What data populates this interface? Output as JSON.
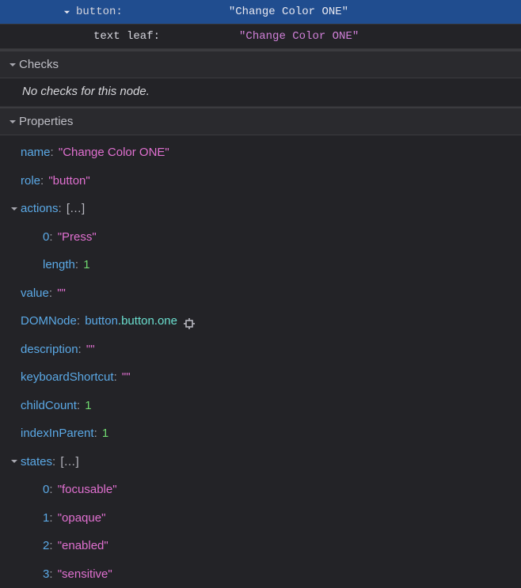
{
  "tree": {
    "node1": {
      "type": "button",
      "text": "\"Change Color ONE\""
    },
    "node2": {
      "type": "text leaf",
      "text": "\"Change Color ONE\""
    }
  },
  "sections": {
    "checks": "Checks",
    "properties": "Properties"
  },
  "checksEmpty": "No checks for this node.",
  "props": {
    "name": {
      "key": "name",
      "val": "\"Change Color ONE\""
    },
    "role": {
      "key": "role",
      "val": "\"button\""
    },
    "actions": {
      "key": "actions",
      "bracket": "[…]"
    },
    "actions_0": {
      "idx": "0",
      "val": "\"Press\""
    },
    "actions_len": {
      "key": "length",
      "val": "1"
    },
    "value": {
      "key": "value",
      "val": "\"\""
    },
    "dom": {
      "key": "DOMNode",
      "tag": "button",
      "cls1": ".button",
      "cls2": ".one"
    },
    "description": {
      "key": "description",
      "val": "\"\""
    },
    "keyboardShortcut": {
      "key": "keyboardShortcut",
      "val": "\"\""
    },
    "childCount": {
      "key": "childCount",
      "val": "1"
    },
    "indexInParent": {
      "key": "indexInParent",
      "val": "1"
    },
    "states": {
      "key": "states",
      "bracket": "[…]"
    },
    "states_0": {
      "idx": "0",
      "val": "\"focusable\""
    },
    "states_1": {
      "idx": "1",
      "val": "\"opaque\""
    },
    "states_2": {
      "idx": "2",
      "val": "\"enabled\""
    },
    "states_3": {
      "idx": "3",
      "val": "\"sensitive\""
    }
  }
}
